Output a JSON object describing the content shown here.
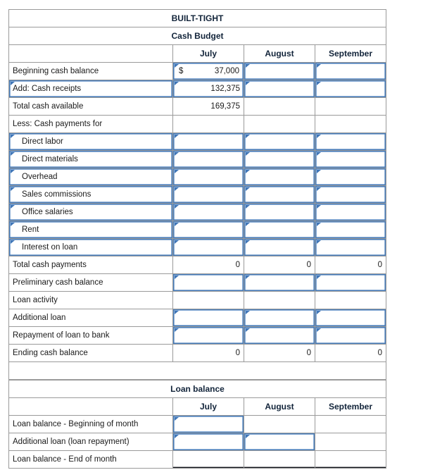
{
  "company": "BUILT-TIGHT",
  "cash_budget": {
    "title": "Cash Budget",
    "months": [
      "July",
      "August",
      "September"
    ],
    "rows": [
      {
        "label": "Beginning cash balance",
        "july": "37,000",
        "currency": "$",
        "august": "",
        "september": ""
      },
      {
        "label": "Add: Cash receipts",
        "july": "132,375",
        "august": "",
        "september": ""
      },
      {
        "label": "Total cash available",
        "july": "169,375",
        "august": "",
        "september": ""
      },
      {
        "label": "Less: Cash payments for",
        "july": "",
        "august": "",
        "september": ""
      },
      {
        "label": "Direct labor",
        "july": "",
        "august": "",
        "september": ""
      },
      {
        "label": "Direct materials",
        "july": "",
        "august": "",
        "september": ""
      },
      {
        "label": "Overhead",
        "july": "",
        "august": "",
        "september": ""
      },
      {
        "label": "Sales commissions",
        "july": "",
        "august": "",
        "september": ""
      },
      {
        "label": "Office salaries",
        "july": "",
        "august": "",
        "september": ""
      },
      {
        "label": "Rent",
        "july": "",
        "august": "",
        "september": ""
      },
      {
        "label": "Interest on loan",
        "july": "",
        "august": "",
        "september": ""
      },
      {
        "label": "Total cash payments",
        "july": "0",
        "august": "0",
        "september": "0"
      },
      {
        "label": "Preliminary cash balance",
        "july": "",
        "august": "",
        "september": ""
      },
      {
        "label": "Loan activity",
        "july": "",
        "august": "",
        "september": ""
      },
      {
        "label": "Additional loan",
        "july": "",
        "august": "",
        "september": ""
      },
      {
        "label": "Repayment of loan to bank",
        "july": "",
        "august": "",
        "september": ""
      },
      {
        "label": "Ending cash balance",
        "july": "0",
        "august": "0",
        "september": "0"
      }
    ]
  },
  "loan_balance": {
    "title": "Loan balance",
    "months": [
      "July",
      "August",
      "September"
    ],
    "rows": [
      {
        "label": "Loan balance - Beginning of month",
        "july": "",
        "august": "",
        "september": ""
      },
      {
        "label": "Additional loan (loan repayment)",
        "july": "",
        "august": "",
        "september": ""
      },
      {
        "label": "Loan balance - End of month",
        "july": "",
        "august": "",
        "september": ""
      }
    ]
  },
  "colors": {
    "header_blue": "#7FAADE",
    "input_border": "#4A7EBB",
    "highlight_yellow": "#FAF7C3",
    "grid_line": "#9A9A9A",
    "rule": "#10131A"
  }
}
